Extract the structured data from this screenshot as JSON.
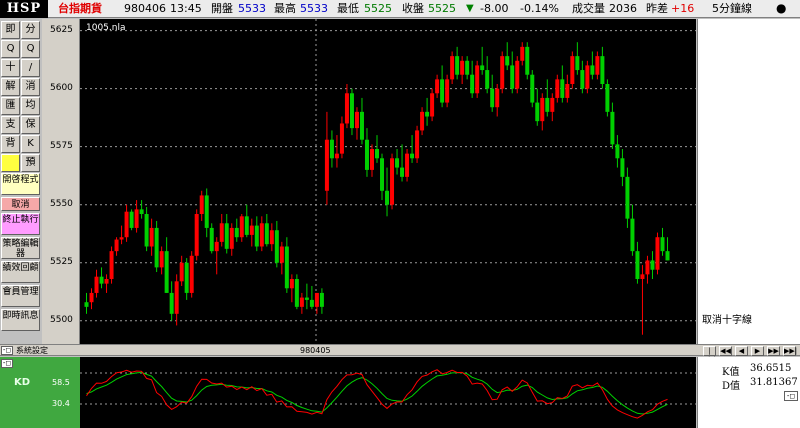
{
  "header": {
    "logo": "HSP",
    "product": "台指期貨",
    "date": "980406",
    "time": "13:45",
    "open_label": "開盤",
    "open": "5533",
    "high_label": "最高",
    "high": "5533",
    "low_label": "最低",
    "low": "5525",
    "close_label": "收盤",
    "close": "5525",
    "change": "-8.00",
    "change_pct": "-0.14%",
    "volume_label": "成交量",
    "volume": "2036",
    "spread_label": "昨差",
    "spread": "+16",
    "period": "5分鐘線"
  },
  "toolbar": [
    {
      "label": "即"
    },
    {
      "label": "分"
    },
    {
      "label": "Q"
    },
    {
      "label": "Q"
    },
    {
      "label": "十"
    },
    {
      "label": "/"
    },
    {
      "label": "解"
    },
    {
      "label": "消"
    },
    {
      "label": "匯"
    },
    {
      "label": "均"
    },
    {
      "label": "支"
    },
    {
      "label": "保"
    },
    {
      "label": "背"
    },
    {
      "label": "K"
    },
    {
      "label": ""
    },
    {
      "label": "預"
    }
  ],
  "toolbar_wide": [
    {
      "label": "開啓程式"
    },
    {
      "label": "取消"
    },
    {
      "label": "終止執行"
    },
    {
      "label": "策略編輯器"
    },
    {
      "label": "績效回顧"
    },
    {
      "label": "會員管理"
    },
    {
      "label": "即時訊息"
    }
  ],
  "chart": {
    "title": "1005.nla",
    "price_ticks": [
      "5625",
      "5600",
      "5575",
      "5550",
      "5525",
      "5500"
    ],
    "up_color": "#ff0000",
    "down_color": "#00d000"
  },
  "right_panel": {
    "cross_toggle": "取消十字線"
  },
  "strip": {
    "sys_label": "系統設定",
    "date_label": "980405",
    "nav": [
      "|◀◀",
      "◀◀",
      "◀",
      "▶",
      "▶▶",
      "▶▶|"
    ]
  },
  "indicator": {
    "name": "KD",
    "levels": [
      "58.5",
      "30.4"
    ],
    "k_label": "K值",
    "k_value": "36.6515",
    "d_label": "D值",
    "d_value": "31.81367",
    "k_color": "#ff0000",
    "d_color": "#00d000"
  },
  "chart_data": {
    "type": "candlestick",
    "ylim": [
      5490,
      5630
    ],
    "ohlc": [
      [
        5508,
        5512,
        5503,
        5506
      ],
      [
        5508,
        5514,
        5505,
        5512
      ],
      [
        5512,
        5522,
        5510,
        5519
      ],
      [
        5519,
        5523,
        5514,
        5516
      ],
      [
        5516,
        5520,
        5512,
        5518
      ],
      [
        5518,
        5532,
        5516,
        5530
      ],
      [
        5530,
        5536,
        5528,
        5535
      ],
      [
        5535,
        5541,
        5533,
        5536
      ],
      [
        5536,
        5550,
        5534,
        5547
      ],
      [
        5547,
        5548,
        5539,
        5540
      ],
      [
        5540,
        5552,
        5538,
        5548
      ],
      [
        5548,
        5552,
        5544,
        5546
      ],
      [
        5546,
        5549,
        5530,
        5532
      ],
      [
        5532,
        5544,
        5528,
        5540
      ],
      [
        5540,
        5543,
        5521,
        5523
      ],
      [
        5523,
        5532,
        5520,
        5530
      ],
      [
        5530,
        5536,
        5512,
        5512
      ],
      [
        5512,
        5517,
        5500,
        5503
      ],
      [
        5503,
        5520,
        5498,
        5517
      ],
      [
        5517,
        5528,
        5515,
        5525
      ],
      [
        5525,
        5527,
        5509,
        5512
      ],
      [
        5512,
        5530,
        5510,
        5528
      ],
      [
        5528,
        5548,
        5526,
        5546
      ],
      [
        5546,
        5556,
        5543,
        5554
      ],
      [
        5554,
        5557,
        5536,
        5540
      ],
      [
        5540,
        5542,
        5529,
        5530
      ],
      [
        5530,
        5536,
        5520,
        5534
      ],
      [
        5534,
        5546,
        5532,
        5542
      ],
      [
        5542,
        5546,
        5529,
        5531
      ],
      [
        5531,
        5542,
        5528,
        5540
      ],
      [
        5540,
        5544,
        5534,
        5536
      ],
      [
        5536,
        5546,
        5534,
        5545
      ],
      [
        5545,
        5550,
        5536,
        5537
      ],
      [
        5537,
        5544,
        5532,
        5541
      ],
      [
        5541,
        5545,
        5530,
        5532
      ],
      [
        5532,
        5545,
        5530,
        5542
      ],
      [
        5542,
        5546,
        5532,
        5533
      ],
      [
        5533,
        5542,
        5530,
        5539
      ],
      [
        5539,
        5543,
        5523,
        5525
      ],
      [
        5525,
        5534,
        5520,
        5532
      ],
      [
        5532,
        5536,
        5512,
        5514
      ],
      [
        5514,
        5520,
        5508,
        5518
      ],
      [
        5518,
        5520,
        5505,
        5506
      ],
      [
        5506,
        5512,
        5503,
        5510
      ],
      [
        5510,
        5516,
        5505,
        5509
      ],
      [
        5509,
        5515,
        5505,
        5506
      ],
      [
        5506,
        5512,
        5503,
        5512
      ],
      [
        5512,
        5514,
        5503,
        5506
      ],
      [
        5556,
        5590,
        5550,
        5578
      ],
      [
        5578,
        5582,
        5566,
        5570
      ],
      [
        5570,
        5580,
        5566,
        5572
      ],
      [
        5572,
        5588,
        5570,
        5585
      ],
      [
        5585,
        5602,
        5583,
        5598
      ],
      [
        5598,
        5600,
        5580,
        5583
      ],
      [
        5583,
        5592,
        5578,
        5590
      ],
      [
        5590,
        5596,
        5576,
        5578
      ],
      [
        5578,
        5583,
        5562,
        5565
      ],
      [
        5565,
        5576,
        5562,
        5574
      ],
      [
        5574,
        5580,
        5568,
        5570
      ],
      [
        5570,
        5572,
        5552,
        5556
      ],
      [
        5556,
        5566,
        5545,
        5550
      ],
      [
        5550,
        5572,
        5548,
        5570
      ],
      [
        5570,
        5574,
        5563,
        5566
      ],
      [
        5566,
        5576,
        5560,
        5562
      ],
      [
        5562,
        5574,
        5560,
        5572
      ],
      [
        5572,
        5580,
        5568,
        5570
      ],
      [
        5570,
        5584,
        5568,
        5582
      ],
      [
        5582,
        5592,
        5580,
        5590
      ],
      [
        5590,
        5596,
        5584,
        5588
      ],
      [
        5588,
        5600,
        5586,
        5598
      ],
      [
        5598,
        5606,
        5596,
        5604
      ],
      [
        5604,
        5610,
        5592,
        5594
      ],
      [
        5594,
        5606,
        5592,
        5604
      ],
      [
        5604,
        5616,
        5602,
        5614
      ],
      [
        5614,
        5618,
        5604,
        5606
      ],
      [
        5606,
        5614,
        5602,
        5612
      ],
      [
        5612,
        5614,
        5604,
        5606
      ],
      [
        5606,
        5612,
        5596,
        5598
      ],
      [
        5598,
        5612,
        5596,
        5610
      ],
      [
        5610,
        5618,
        5606,
        5608
      ],
      [
        5608,
        5614,
        5598,
        5600
      ],
      [
        5600,
        5606,
        5590,
        5592
      ],
      [
        5592,
        5602,
        5588,
        5600
      ],
      [
        5600,
        5616,
        5598,
        5614
      ],
      [
        5614,
        5620,
        5608,
        5610
      ],
      [
        5610,
        5616,
        5598,
        5600
      ],
      [
        5600,
        5614,
        5598,
        5612
      ],
      [
        5612,
        5620,
        5610,
        5618
      ],
      [
        5618,
        5620,
        5604,
        5606
      ],
      [
        5606,
        5608,
        5592,
        5594
      ],
      [
        5594,
        5600,
        5584,
        5586
      ],
      [
        5586,
        5598,
        5582,
        5596
      ],
      [
        5596,
        5604,
        5588,
        5590
      ],
      [
        5590,
        5598,
        5586,
        5596
      ],
      [
        5596,
        5606,
        5594,
        5604
      ],
      [
        5604,
        5610,
        5594,
        5596
      ],
      [
        5596,
        5606,
        5594,
        5602
      ],
      [
        5602,
        5616,
        5600,
        5614
      ],
      [
        5614,
        5620,
        5606,
        5608
      ],
      [
        5608,
        5612,
        5598,
        5600
      ],
      [
        5600,
        5612,
        5598,
        5610
      ],
      [
        5610,
        5616,
        5604,
        5606
      ],
      [
        5606,
        5616,
        5604,
        5614
      ],
      [
        5614,
        5618,
        5600,
        5602
      ],
      [
        5602,
        5604,
        5588,
        5590
      ],
      [
        5590,
        5594,
        5574,
        5576
      ],
      [
        5576,
        5580,
        5566,
        5570
      ],
      [
        5570,
        5574,
        5558,
        5562
      ],
      [
        5562,
        5566,
        5540,
        5544
      ],
      [
        5544,
        5550,
        5528,
        5530
      ],
      [
        5530,
        5534,
        5516,
        5518
      ],
      [
        5518,
        5524,
        5494,
        5520
      ],
      [
        5520,
        5528,
        5516,
        5526
      ],
      [
        5526,
        5530,
        5518,
        5522
      ],
      [
        5522,
        5538,
        5520,
        5536
      ],
      [
        5536,
        5540,
        5528,
        5530
      ],
      [
        5530,
        5536,
        5526,
        5526
      ]
    ]
  }
}
